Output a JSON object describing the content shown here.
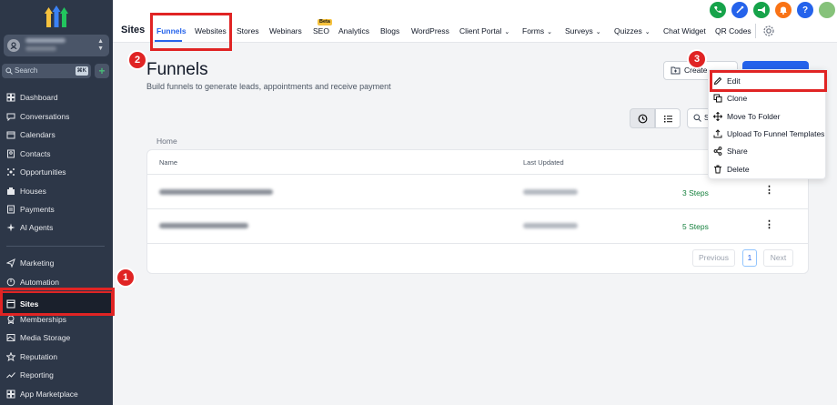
{
  "sidebar": {
    "search_placeholder": "Search",
    "search_shortcut": "⌘K",
    "add_label": "+",
    "items": [
      {
        "label": "Dashboard",
        "icon": "dashboard-icon"
      },
      {
        "label": "Conversations",
        "icon": "chat-icon"
      },
      {
        "label": "Calendars",
        "icon": "calendar-icon"
      },
      {
        "label": "Contacts",
        "icon": "contacts-icon"
      },
      {
        "label": "Opportunities",
        "icon": "opportunities-icon"
      },
      {
        "label": "Houses",
        "icon": "house-icon"
      },
      {
        "label": "Payments",
        "icon": "payments-icon"
      },
      {
        "label": "AI Agents",
        "icon": "ai-agents-icon"
      },
      {
        "label": "Marketing",
        "icon": "marketing-icon"
      },
      {
        "label": "Automation",
        "icon": "automation-icon"
      },
      {
        "label": "Sites",
        "icon": "sites-icon"
      },
      {
        "label": "Memberships",
        "icon": "memberships-icon"
      },
      {
        "label": "Media Storage",
        "icon": "media-icon"
      },
      {
        "label": "Reputation",
        "icon": "star-icon"
      },
      {
        "label": "Reporting",
        "icon": "reporting-icon"
      },
      {
        "label": "App Marketplace",
        "icon": "marketplace-icon"
      }
    ]
  },
  "topbar": {
    "section_title": "Sites",
    "tabs": [
      {
        "label": "Funnels"
      },
      {
        "label": "Websites"
      },
      {
        "label": "Stores"
      },
      {
        "label": "Webinars"
      },
      {
        "label": "SEO"
      },
      {
        "label": "Analytics"
      },
      {
        "label": "Blogs"
      },
      {
        "label": "WordPress"
      },
      {
        "label": "Client Portal"
      },
      {
        "label": "Forms"
      },
      {
        "label": "Surveys"
      },
      {
        "label": "Quizzes"
      },
      {
        "label": "Chat Widget"
      },
      {
        "label": "QR Codes"
      }
    ],
    "beta_label": "Beta",
    "help_label": "?"
  },
  "main": {
    "title": "Funnels",
    "subtitle": "Build funnels to generate leads, appointments and receive payment",
    "create_label": "Create",
    "search_label": "S",
    "breadcrumb": "Home",
    "columns": [
      "Name",
      "Last Updated"
    ],
    "rows": [
      {
        "steps": "3 Steps"
      },
      {
        "steps": "5 Steps"
      }
    ],
    "pagination": {
      "previous": "Previous",
      "current": "1",
      "next": "Next"
    }
  },
  "context_menu": {
    "items": [
      {
        "label": "Edit",
        "icon": "pencil-icon"
      },
      {
        "label": "Clone",
        "icon": "clone-icon"
      },
      {
        "label": "Move To Folder",
        "icon": "move-icon"
      },
      {
        "label": "Upload To Funnel Templates",
        "icon": "upload-icon"
      },
      {
        "label": "Share",
        "icon": "share-icon"
      },
      {
        "label": "Delete",
        "icon": "trash-icon"
      }
    ]
  },
  "annotations": {
    "step1": "1",
    "step2": "2",
    "step3": "3"
  },
  "colors": {
    "accent": "#2563eb",
    "highlight": "#e02424",
    "sidebar_bg": "#2d3748",
    "success": "#15803d"
  }
}
